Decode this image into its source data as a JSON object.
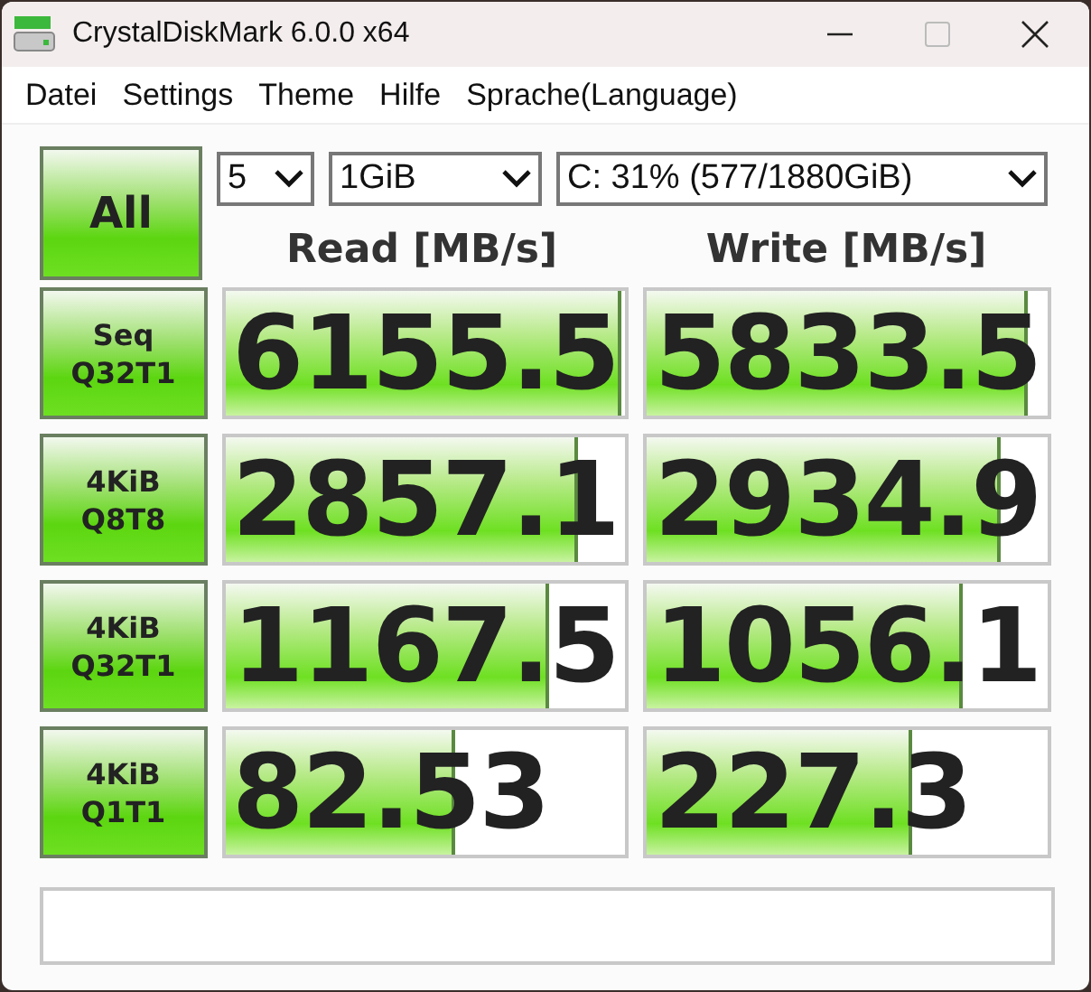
{
  "window": {
    "title": "CrystalDiskMark 6.0.0 x64"
  },
  "menu": [
    "Datei",
    "Settings",
    "Theme",
    "Hilfe",
    "Sprache(Language)"
  ],
  "all_button": "All",
  "selects": [
    {
      "value": "5"
    },
    {
      "value": "1GiB"
    },
    {
      "value": "C: 31% (577/1880GiB)"
    }
  ],
  "headers": [
    "Read [MB/s]",
    "Write [MB/s]"
  ],
  "rows": [
    {
      "label": [
        "Seq",
        "Q32T1"
      ],
      "read": {
        "value": "6155.5",
        "level": 0.99
      },
      "write": {
        "value": "5833.5",
        "level": 0.95
      }
    },
    {
      "label": [
        "4KiB",
        "Q8T8"
      ],
      "read": {
        "value": "2857.1",
        "level": 0.88
      },
      "write": {
        "value": "2934.9",
        "level": 0.885
      }
    },
    {
      "label": [
        "4KiB",
        "Q32T1"
      ],
      "read": {
        "value": "1167.5",
        "level": 0.81
      },
      "write": {
        "value": "1056.1",
        "level": 0.79
      }
    },
    {
      "label": [
        "4KiB",
        "Q1T1"
      ],
      "read": {
        "value": "82.53",
        "level": 0.575
      },
      "write": {
        "value": "227.3",
        "level": 0.66
      }
    }
  ]
}
